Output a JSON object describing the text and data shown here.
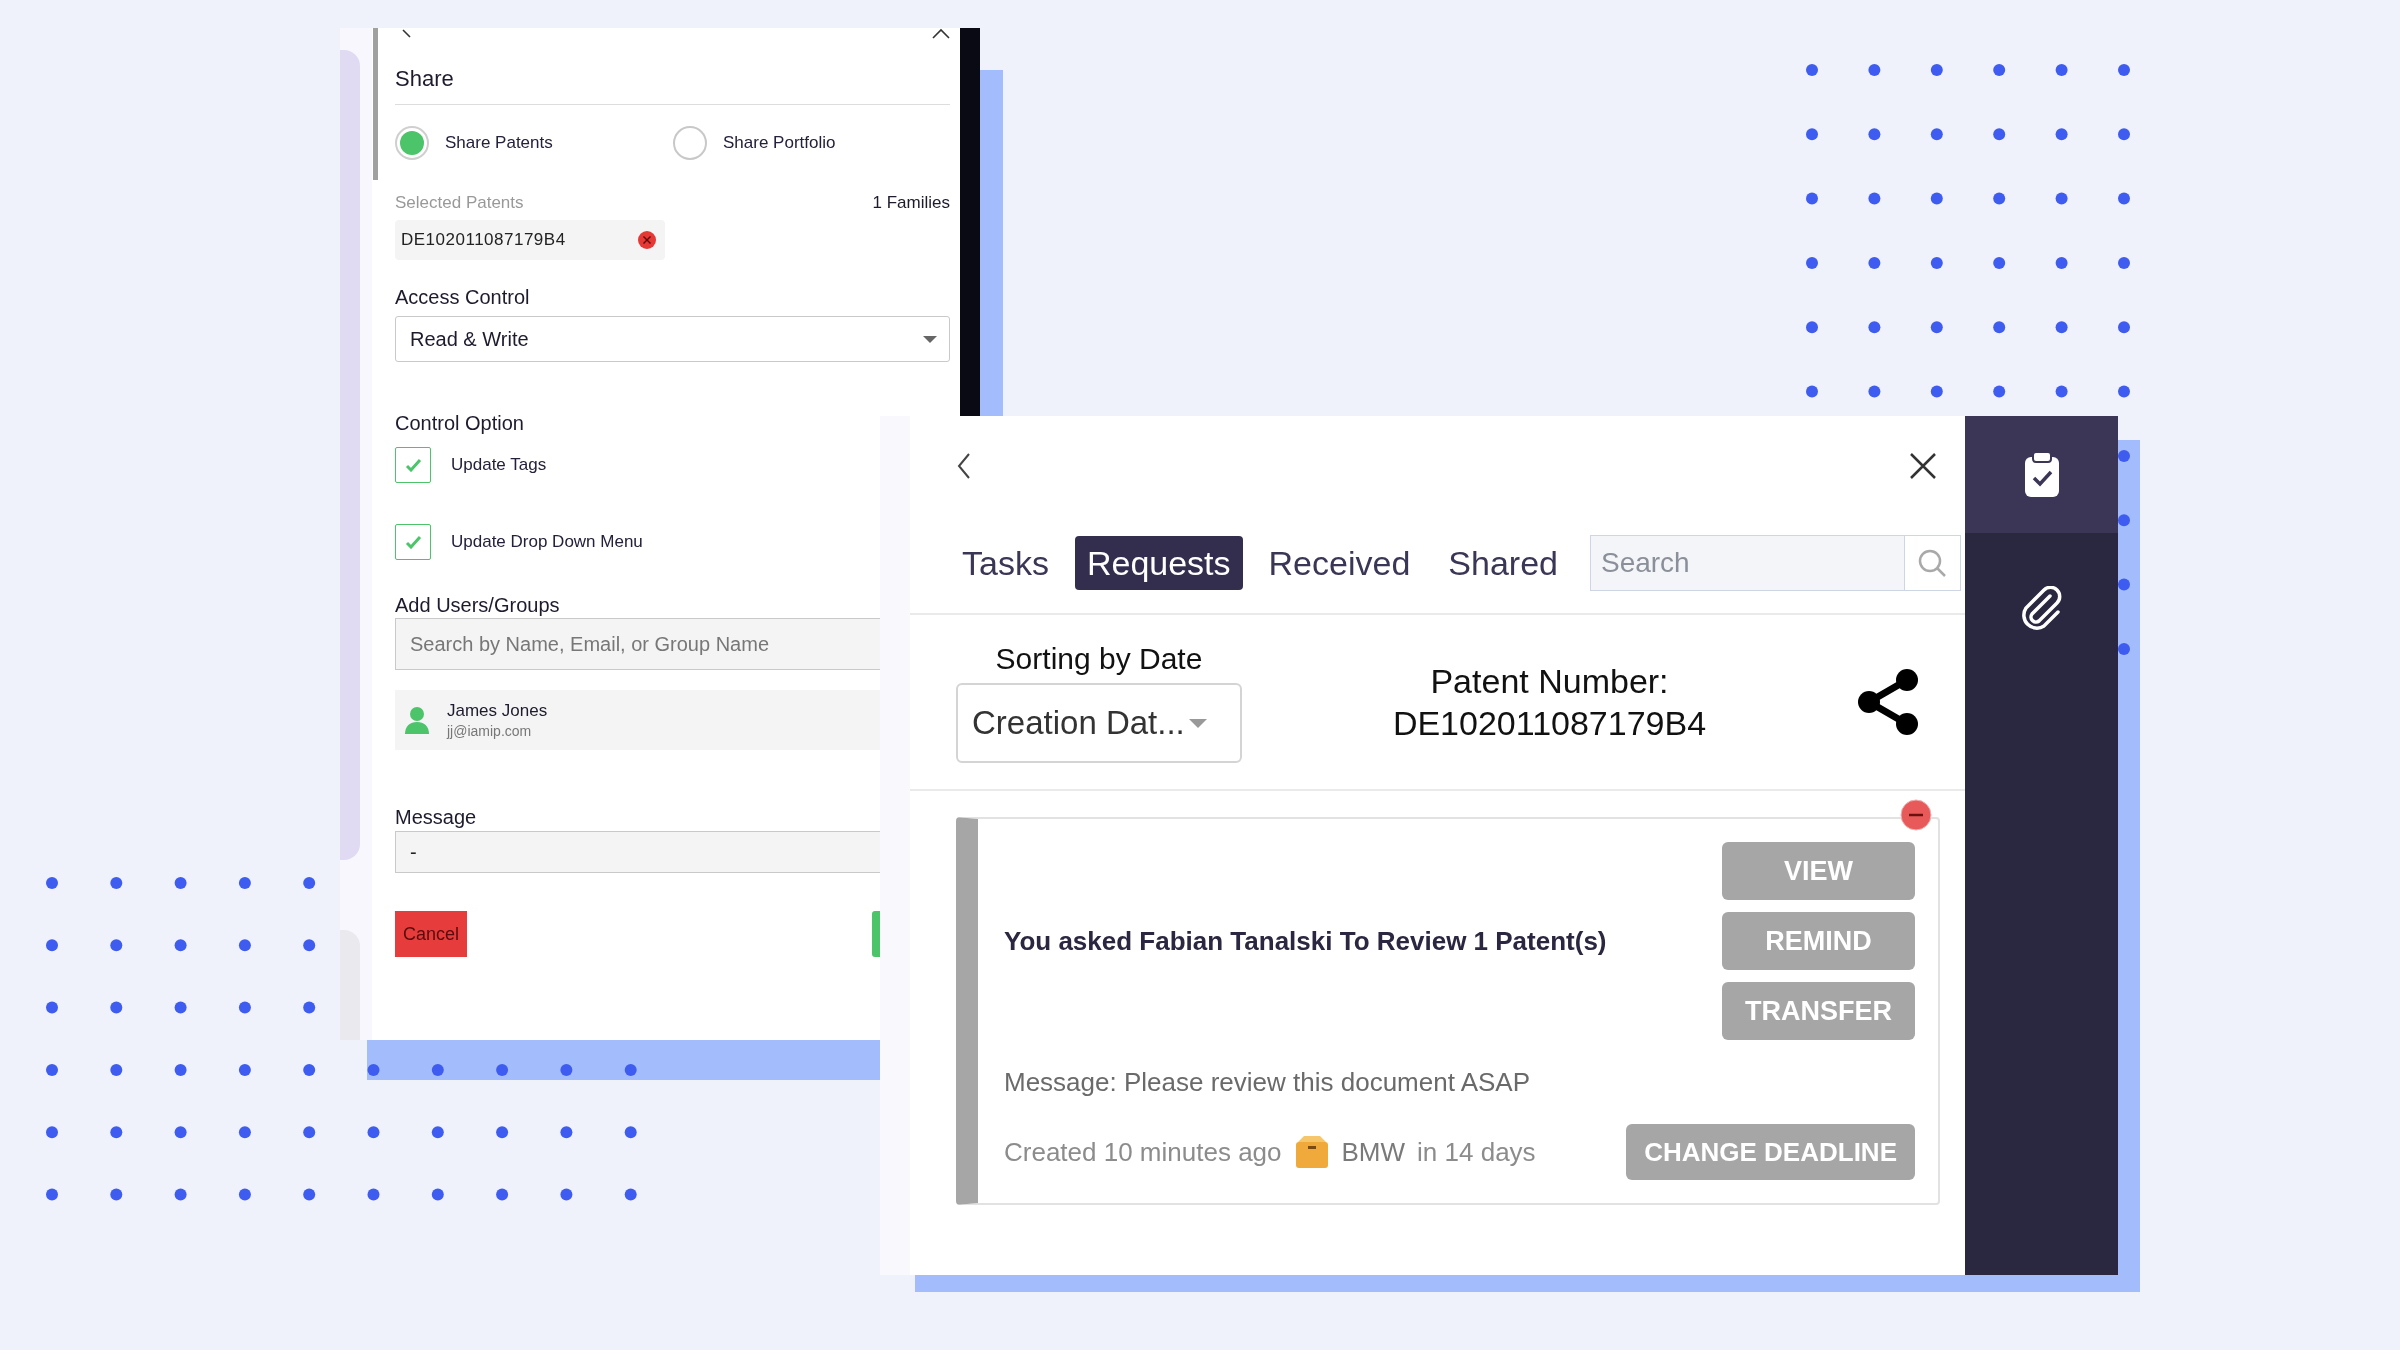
{
  "share_panel": {
    "title": "Share",
    "options": [
      {
        "label": "Share Patents",
        "selected": true
      },
      {
        "label": "Share Portfolio",
        "selected": false
      }
    ],
    "selected_patents": {
      "label": "Selected Patents",
      "count": "1 Families",
      "chips": [
        "DE102011087179B4"
      ]
    },
    "access_control": {
      "label": "Access Control",
      "value": "Read & Write"
    },
    "control_option": {
      "label": "Control Option",
      "items": [
        {
          "label": "Update Tags",
          "checked": true
        },
        {
          "label": "Update Drop Down Menu",
          "checked": true
        }
      ]
    },
    "add_users": {
      "label": "Add Users/Groups",
      "placeholder": "Search by Name, Email, or Group Name",
      "users": [
        {
          "name": "James Jones",
          "email": "jj@iamip.com"
        }
      ]
    },
    "message": {
      "label": "Message",
      "value": "-"
    },
    "buttons": [
      {
        "label": "Cancel",
        "kind": "cancel"
      }
    ]
  },
  "requests_panel": {
    "tabs": [
      {
        "label": "Tasks",
        "selected": false
      },
      {
        "label": "Requests",
        "selected": true
      },
      {
        "label": "Received",
        "selected": false
      },
      {
        "label": "Shared",
        "selected": false
      }
    ],
    "search": {
      "placeholder": "Search"
    },
    "sort": {
      "label": "Sorting by Date",
      "value": "Creation Dat..."
    },
    "patent": {
      "label": "Patent Number:",
      "number": "DE102011087179B4"
    },
    "requests": [
      {
        "title": "You asked Fabian Tanalski To Review 1 Patent(s)",
        "actions": [
          "VIEW",
          "REMIND",
          "TRANSFER"
        ],
        "message": "Message: Please review this document ASAP",
        "created": "Created 10 minutes ago",
        "project": "BMW",
        "due": "in 14 days",
        "deadline_action": "CHANGE DEADLINE"
      }
    ]
  },
  "sidebar": {
    "items": [
      {
        "kind": "clipboard",
        "selected": true
      },
      {
        "kind": "paperclip",
        "selected": false
      }
    ]
  }
}
